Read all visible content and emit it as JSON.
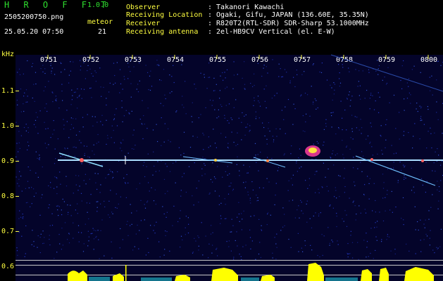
{
  "app": {
    "title": "H R O F F T",
    "version": "1.0.0",
    "filename": "2505200750.png",
    "datetime": "25.05.20 07:50",
    "meteor_label": "meteor",
    "meteor_count": "21"
  },
  "info": {
    "observer_label": "Observer",
    "observer_value": ": Takanori Kawachi",
    "location_label": "Receiving Location",
    "location_value": ": Ogaki, Gifu, JAPAN (136.60E, 35.35N)",
    "receiver_label": "Receiver",
    "receiver_value": ": R820T2(RTL-SDR) SDR-Sharp 53.1000MHz",
    "antenna_label": "Receiving antenna",
    "antenna_value": ": 2el-HB9CV Vertical (el. E-W)"
  },
  "axis": {
    "unit": "kHz",
    "y_ticks": [
      "1.1",
      "1.0",
      "0.9",
      "0.8",
      "0.7",
      "0.6"
    ],
    "x_ticks": [
      "0751",
      "0752",
      "0753",
      "0754",
      "0755",
      "0756",
      "0757",
      "0758",
      "0759",
      "0800"
    ]
  },
  "colors": {
    "background": "#000000",
    "plot_bg": "#04042a",
    "title": "#2fe02f",
    "labels": "#ffff40",
    "text": "#ffffff",
    "carrier": "#9ad8ff",
    "count_bars": "#ffff00"
  }
}
